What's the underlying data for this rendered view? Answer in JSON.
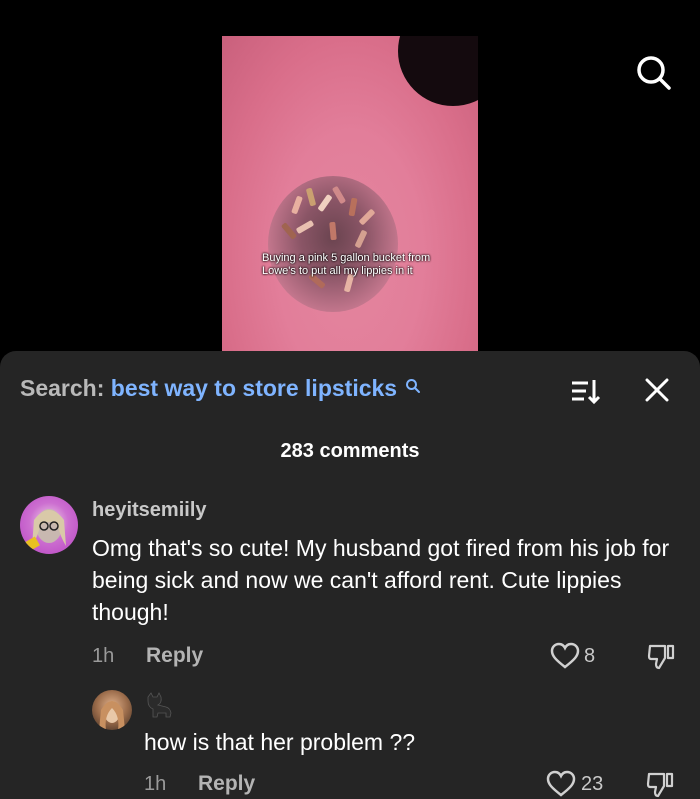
{
  "video": {
    "caption": "Buying a pink 5 gallon bucket from Lowe's to put all my lippies in it"
  },
  "panel": {
    "search_label": "Search:",
    "search_query": "best way to store lipsticks",
    "comment_count": "283 comments"
  },
  "comments": [
    {
      "username": "heyitsemiily",
      "text": "Omg that's so cute! My husband got fired from his job for being sick and now we can't afford rent. Cute lippies though!",
      "time": "1h",
      "reply_label": "Reply",
      "likes": "8"
    }
  ],
  "replies": [
    {
      "username_icon": "cat-icon",
      "text": "how is that her problem ??",
      "time": "1h",
      "reply_label": "Reply",
      "likes": "23"
    }
  ],
  "colors": {
    "panel_bg": "#252525",
    "accent_link": "#7fb4ff",
    "page_bg": "#000000"
  }
}
